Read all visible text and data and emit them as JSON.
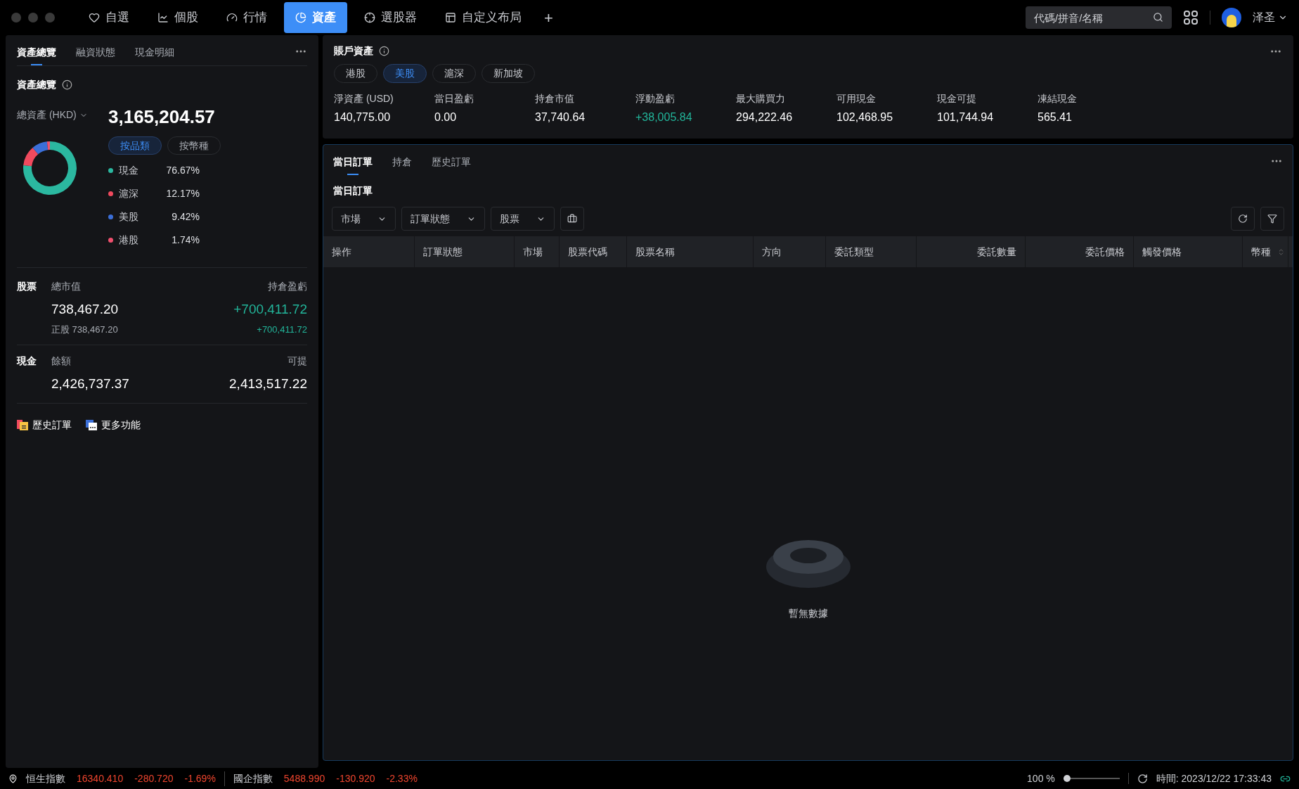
{
  "nav": {
    "tabs": [
      {
        "label": "自選",
        "selected": false
      },
      {
        "label": "個股",
        "selected": false
      },
      {
        "label": "行情",
        "selected": false
      },
      {
        "label": "資產",
        "selected": true
      },
      {
        "label": "選股器",
        "selected": false
      },
      {
        "label": "自定义布局",
        "selected": false
      }
    ],
    "add": "+",
    "search": {
      "placeholder": "代碼/拼音/名稱"
    },
    "user": "泽圣"
  },
  "overview": {
    "tabs": [
      {
        "label": "資產總覽",
        "selected": true
      },
      {
        "label": "融資狀態",
        "selected": false
      },
      {
        "label": "現金明細",
        "selected": false
      }
    ],
    "title": "資產總覽",
    "total_label": "總資產 (HKD)",
    "total": "3,165,204.57",
    "toggles": [
      {
        "label": "按品類",
        "selected": true
      },
      {
        "label": "按幣種",
        "selected": false
      }
    ],
    "legend": [
      {
        "label": "現金",
        "value": "76.67%",
        "color": "#2bb8a0"
      },
      {
        "label": "滬深",
        "value": "12.17%",
        "color": "#f04a5e"
      },
      {
        "label": "美股",
        "value": "9.42%",
        "color": "#3b6fd8"
      },
      {
        "label": "港股",
        "value": "1.74%",
        "color": "#f0506e"
      }
    ],
    "stocks": {
      "label": "股票",
      "value_label": "總市值",
      "pl_label": "持倉盈虧",
      "value": "738,467.20",
      "pl": "+700,411.72",
      "sub_value": "正股 738,467.20",
      "sub_pl": "+700,411.72"
    },
    "cash": {
      "label": "現金",
      "balance_label": "餘額",
      "withdraw_label": "可提",
      "balance": "2,426,737.37",
      "withdraw": "2,413,517.22"
    },
    "links": [
      "歷史訂單",
      "更多功能"
    ]
  },
  "account": {
    "title": "賬戶資產",
    "markets": [
      {
        "label": "港股",
        "selected": false
      },
      {
        "label": "美股",
        "selected": true
      },
      {
        "label": "滬深",
        "selected": false
      },
      {
        "label": "新加坡",
        "selected": false
      }
    ],
    "metrics": [
      {
        "label": "淨資產 (USD)",
        "value": "140,775.00",
        "positive": false
      },
      {
        "label": "當日盈虧",
        "value": "0.00",
        "positive": false
      },
      {
        "label": "持倉市值",
        "value": "37,740.64",
        "positive": false
      },
      {
        "label": "浮動盈虧",
        "value": "+38,005.84",
        "positive": true
      },
      {
        "label": "最大購買力",
        "value": "294,222.46",
        "positive": false
      },
      {
        "label": "可用現金",
        "value": "102,468.95",
        "positive": false
      },
      {
        "label": "現金可提",
        "value": "101,744.94",
        "positive": false
      },
      {
        "label": "凍結現金",
        "value": "565.41",
        "positive": false
      }
    ]
  },
  "orders": {
    "tabs": [
      {
        "label": "當日訂單",
        "selected": true
      },
      {
        "label": "持倉",
        "selected": false
      },
      {
        "label": "歷史訂單",
        "selected": false
      }
    ],
    "title": "當日訂單",
    "filters": [
      "市場",
      "訂單狀態",
      "股票"
    ],
    "columns": [
      "操作",
      "訂單狀態",
      "市場",
      "股票代碼",
      "股票名稱",
      "方向",
      "委託類型",
      "委託數量",
      "委託價格",
      "觸發價格",
      "幣種"
    ],
    "empty": "暫無數據"
  },
  "status_bar": {
    "indices": [
      {
        "name": "恒生指數",
        "price": "16340.410",
        "change": "-280.720",
        "percent": "-1.69%"
      },
      {
        "name": "國企指數",
        "price": "5488.990",
        "change": "-130.920",
        "percent": "-2.33%"
      }
    ],
    "zoom": {
      "label": "100 %",
      "level": 0
    },
    "time": "時間: 2023/12/22 17:33:43"
  }
}
